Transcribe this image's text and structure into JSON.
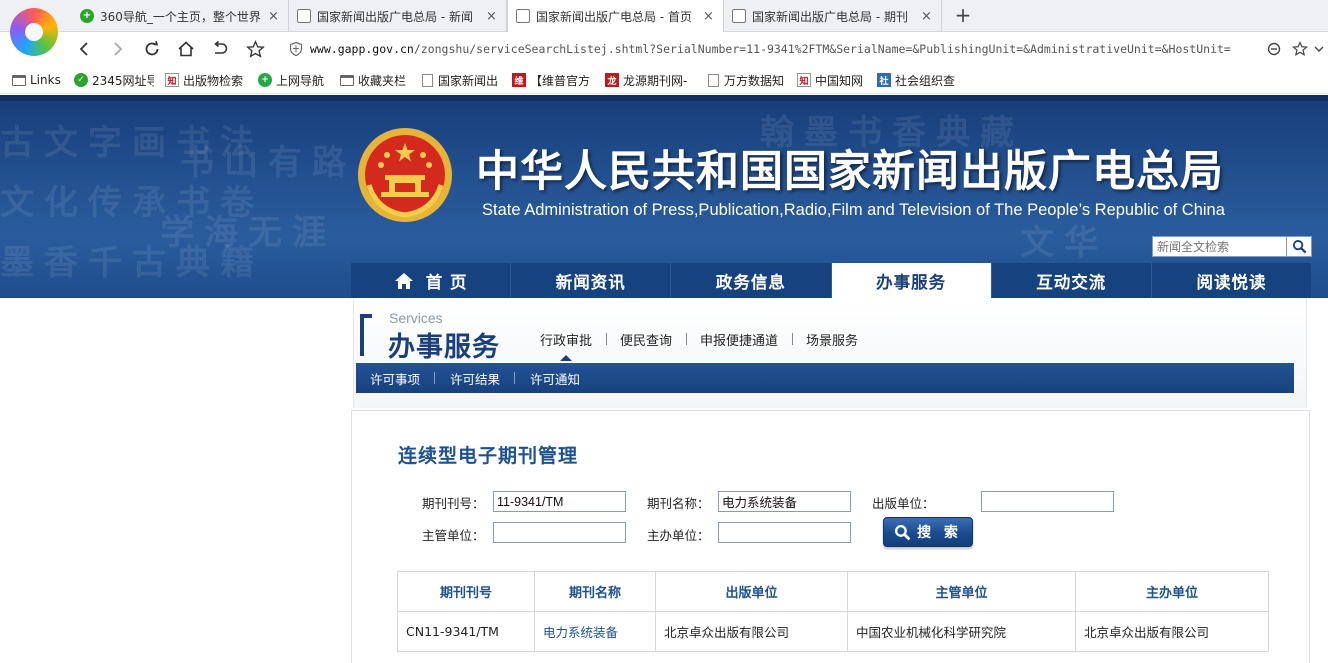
{
  "browser": {
    "tabs": [
      {
        "label": "360导航_一个主页，整个世界",
        "icon": "360-icon"
      },
      {
        "label": "国家新闻出版广电总局 - 新闻",
        "icon": "page-icon"
      },
      {
        "label": "国家新闻出版广电总局 - 首页",
        "icon": "page-icon",
        "active": true
      },
      {
        "label": "国家新闻出版广电总局 - 期刊",
        "icon": "page-icon"
      }
    ],
    "tab_close_glyph": "×",
    "new_tab_glyph": "+",
    "address": {
      "domain": "www.gapp.gov.cn",
      "path": "/zongshu/serviceSearchListej.shtml?SerialNumber=11-9341%2FTM&SerialName=&PublishingUnit=&AdministrativeUnit=&HostUnit="
    },
    "bookmarks": [
      {
        "label": "Links",
        "icon": "folder-icon"
      },
      {
        "label": "2345网址导",
        "icon": "2345-icon"
      },
      {
        "label": "出版物检索",
        "icon": "zhi-icon"
      },
      {
        "label": "上网导航",
        "icon": "360-icon"
      },
      {
        "label": "收藏夹栏",
        "icon": "folder-icon"
      },
      {
        "label": "国家新闻出",
        "icon": "page-icon"
      },
      {
        "label": "【维普官方",
        "icon": "weipu-icon"
      },
      {
        "label": "龙源期刊网-",
        "icon": "longyuan-icon"
      },
      {
        "label": "万方数据知",
        "icon": "page-icon"
      },
      {
        "label": "中国知网",
        "icon": "zhi-icon"
      },
      {
        "label": "社会组织查",
        "icon": "org-icon"
      }
    ]
  },
  "site": {
    "title": "中华人民共和国国家新闻出版广电总局",
    "subtitle": "State Administration of Press,Publication,Radio,Film and Television of The People’s Republic of China",
    "search_placeholder": "新闻全文检索",
    "nav": [
      {
        "label": "首 页",
        "home": true
      },
      {
        "label": "新闻资讯"
      },
      {
        "label": "政务信息"
      },
      {
        "label": "办事服务",
        "active": true
      },
      {
        "label": "互动交流"
      },
      {
        "label": "阅读悦读"
      }
    ]
  },
  "services": {
    "title_en": "Services",
    "title_cn": "办事服务",
    "subnav": [
      "行政审批",
      "便民查询",
      "申报便捷通道",
      "场景服务"
    ],
    "bar": [
      "许可事项",
      "许可结果",
      "许可通知"
    ]
  },
  "panel": {
    "title": "连续型电子期刊管理",
    "form": {
      "serial_number_label": "期刊刊号：",
      "serial_number_value": "11-9341/TM",
      "serial_name_label": "期刊名称：",
      "serial_name_value": "电力系统装备",
      "publishing_unit_label": "出版单位：",
      "publishing_unit_value": "",
      "administrative_unit_label": "主管单位：",
      "administrative_unit_value": "",
      "host_unit_label": "主办单位：",
      "host_unit_value": "",
      "search_label": "搜 索"
    },
    "table": {
      "headers": [
        "期刊刊号",
        "期刊名称",
        "出版单位",
        "主管单位",
        "主办单位"
      ],
      "rows": [
        [
          "CN11-9341/TM",
          "电力系统装备",
          "北京卓众出版有限公司",
          "中国农业机械化科学研究院",
          "北京卓众出版有限公司"
        ]
      ]
    }
  }
}
